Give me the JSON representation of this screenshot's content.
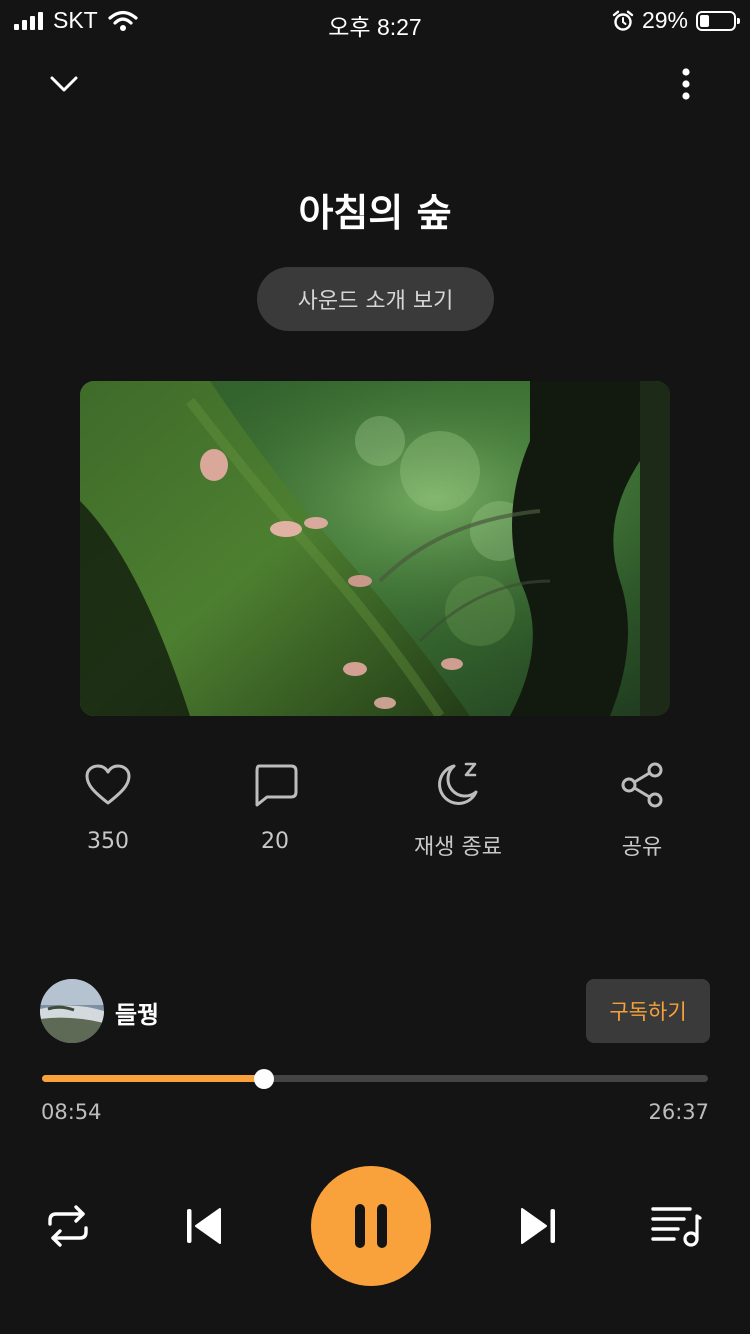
{
  "status_bar": {
    "carrier": "SKT",
    "time": "오후 8:27",
    "battery_percent": "29%",
    "battery_level": 0.29
  },
  "header": {
    "collapse_icon": "chevron-down-icon",
    "more_icon": "more-vertical-icon"
  },
  "track": {
    "title": "아침의 숲",
    "intro_label": "사운드 소개 보기",
    "artwork": "forest-moss-mushrooms-image"
  },
  "actions": [
    {
      "icon": "heart-icon",
      "label": "350"
    },
    {
      "icon": "comment-icon",
      "label": "20"
    },
    {
      "icon": "sleep-timer-icon",
      "label": "재생 종료"
    },
    {
      "icon": "share-icon",
      "label": "공유"
    }
  ],
  "creator": {
    "name": "들꿩",
    "subscribe_label": "구독하기"
  },
  "progress": {
    "elapsed": "08:54",
    "total": "26:37",
    "fraction": 0.334
  },
  "controls": {
    "repeat_icon": "repeat-icon",
    "previous_icon": "skip-previous-icon",
    "play_pause_icon": "pause-icon",
    "next_icon": "skip-next-icon",
    "playlist_icon": "playlist-icon"
  },
  "colors": {
    "accent": "#f9a13a",
    "background": "#141414",
    "button_bg": "#3a3a3a"
  }
}
